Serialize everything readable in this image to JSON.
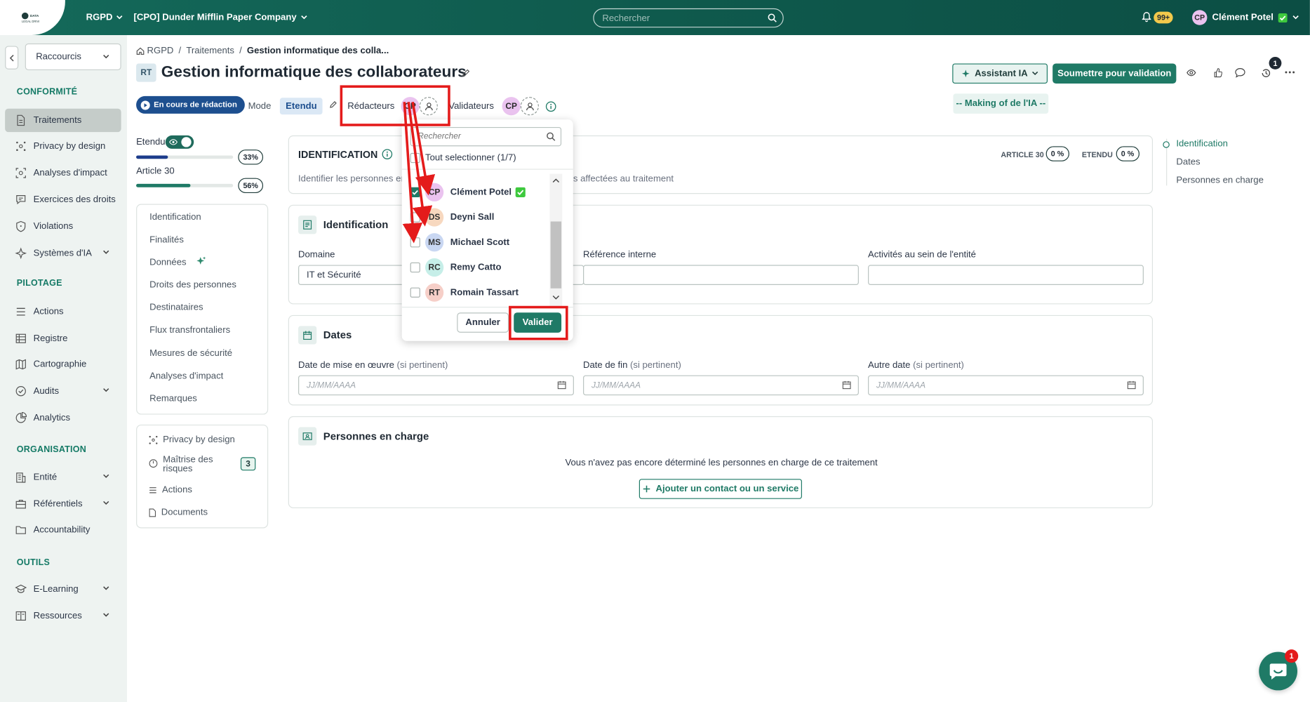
{
  "topbar": {
    "logo": "DATA LEGAL DRIVE",
    "module": "RGPD",
    "company": "[CPO] Dunder Mifflin Paper Company",
    "search_placeholder": "Rechercher",
    "notif_count": "99+",
    "user_initials": "CP",
    "user_name": "Clément Potel"
  },
  "sidebar": {
    "shortcuts": "Raccourcis",
    "sections": [
      {
        "title": "CONFORMITÉ",
        "items": [
          {
            "label": "Traitements",
            "icon": "document-icon",
            "active": true
          },
          {
            "label": "Privacy by design",
            "icon": "network-icon"
          },
          {
            "label": "Analyses d'impact",
            "icon": "analysis-icon"
          },
          {
            "label": "Exercices des droits",
            "icon": "chat-icon"
          },
          {
            "label": "Violations",
            "icon": "shield-icon"
          },
          {
            "label": "Systèmes d'IA",
            "icon": "ai-icon",
            "chevron": true
          }
        ]
      },
      {
        "title": "PILOTAGE",
        "items": [
          {
            "label": "Actions",
            "icon": "list-icon"
          },
          {
            "label": "Registre",
            "icon": "table-icon"
          },
          {
            "label": "Cartographie",
            "icon": "map-icon"
          },
          {
            "label": "Audits",
            "icon": "check-circle-icon",
            "chevron": true
          },
          {
            "label": "Analytics",
            "icon": "pie-chart-icon"
          }
        ]
      },
      {
        "title": "ORGANISATION",
        "items": [
          {
            "label": "Entité",
            "icon": "building-icon",
            "chevron": true
          },
          {
            "label": "Référentiels",
            "icon": "briefcase-icon",
            "chevron": true
          },
          {
            "label": "Accountability",
            "icon": "folder-icon"
          }
        ]
      },
      {
        "title": "OUTILS",
        "items": [
          {
            "label": "E-Learning",
            "icon": "graduation-icon",
            "chevron": true
          },
          {
            "label": "Ressources",
            "icon": "book-icon",
            "chevron": true
          }
        ]
      }
    ]
  },
  "breadcrumb": {
    "root": "RGPD",
    "level1": "Traitements",
    "current": "Gestion informatique des colla..."
  },
  "header": {
    "badge": "RT",
    "title": "Gestion informatique des collaborateurs",
    "status": "En cours de rédaction",
    "mode_label": "Mode",
    "mode_value": "Etendu",
    "redacteurs_label": "Rédacteurs",
    "validateurs_label": "Validateurs",
    "avatar_initials": "CP",
    "assistant_ia": "Assistant IA",
    "submit": "Soumettre pour validation",
    "making_of": "-- Making of de l'IA --",
    "history_count": "1"
  },
  "progress": {
    "toggle_label": "Etendu",
    "items": [
      {
        "label": "",
        "value": "33%",
        "fraction": 0.33,
        "color": "#1d3c8c"
      },
      {
        "label": "Article 30",
        "value": "56%",
        "fraction": 0.56,
        "color": "#1f7a66"
      }
    ]
  },
  "left_nav": [
    "Identification",
    "Finalités",
    "Données",
    "Droits des personnes",
    "Destinataires",
    "Flux transfrontaliers",
    "Mesures de sécurité",
    "Analyses d'impact",
    "Remarques"
  ],
  "left_nav2": {
    "privacy": "Privacy by design",
    "risk_line1": "Maîtrise des",
    "risk_line2": "risques",
    "risk_count": "3",
    "actions": "Actions",
    "documents": "Documents"
  },
  "identification_card": {
    "title": "IDENTIFICATION",
    "description_left": "Identifier les personnes en",
    "description_right": "ns affectées au traitement",
    "article30": "ARTICLE 30",
    "article30_pct": "0 %",
    "etendu": "ETENDU",
    "etendu_pct": "0 %"
  },
  "identification_section": {
    "title": "Identification",
    "domaine_label": "Domaine",
    "domaine_value": "IT et Sécurité",
    "ref_label": "Référence interne",
    "activites_label": "Activités au sein de l'entité"
  },
  "dates_section": {
    "title": "Dates",
    "fields": [
      {
        "label": "Date de mise en œuvre",
        "hint": "(si pertinent)",
        "placeholder": "JJ/MM/AAAA"
      },
      {
        "label": "Date de fin",
        "hint": "(si pertinent)",
        "placeholder": "JJ/MM/AAAA"
      },
      {
        "label": "Autre date",
        "hint": "(si pertinent)",
        "placeholder": "JJ/MM/AAAA"
      }
    ]
  },
  "persons_section": {
    "title": "Personnes en charge",
    "empty_text": "Vous n'avez pas encore déterminé les personnes en charge de ce traitement",
    "add_button": "Ajouter un contact ou un service"
  },
  "right_nav": [
    "Identification",
    "Dates",
    "Personnes en charge"
  ],
  "dropdown": {
    "search_placeholder": "Rechercher",
    "select_all": "Tout selectionner (1/7)",
    "users": [
      {
        "initials": "CP",
        "name": "Clément Potel",
        "checked": true,
        "verified": true,
        "color": "#eac3ef"
      },
      {
        "initials": "DS",
        "name": "Deyni Sall",
        "checked": false,
        "color": "#f7d8bf"
      },
      {
        "initials": "MS",
        "name": "Michael Scott",
        "checked": false,
        "color": "#c9d7f2"
      },
      {
        "initials": "RC",
        "name": "Remy Catto",
        "checked": false,
        "color": "#c6eee8"
      },
      {
        "initials": "RT",
        "name": "Romain Tassart",
        "checked": false,
        "color": "#f6cfc8"
      }
    ],
    "cancel": "Annuler",
    "validate": "Valider"
  },
  "chat": {
    "count": "1"
  },
  "colors": {
    "primary": "#1f7a66",
    "topbar": "#0f5a4d",
    "annotation": "#e41b1b"
  }
}
